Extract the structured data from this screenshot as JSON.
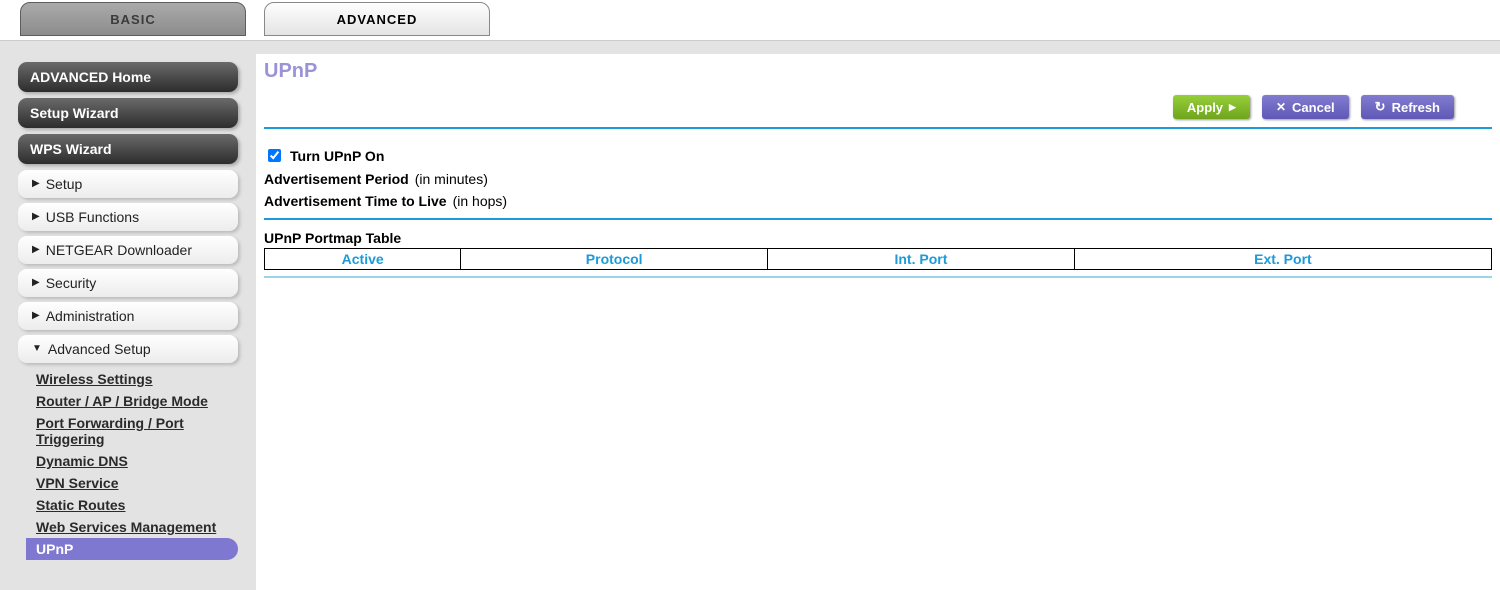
{
  "tabs": {
    "basic": "BASIC",
    "advanced": "ADVANCED"
  },
  "sidebar": {
    "advanced_home": "ADVANCED Home",
    "setup_wizard": "Setup Wizard",
    "wps_wizard": "WPS Wizard",
    "setup": "Setup",
    "usb_functions": "USB Functions",
    "netgear_downloader": "NETGEAR Downloader",
    "security": "Security",
    "administration": "Administration",
    "advanced_setup": "Advanced Setup",
    "sub": {
      "wireless_settings": "Wireless Settings",
      "router_mode": "Router / AP / Bridge Mode",
      "port_forwarding": "Port Forwarding / Port Triggering",
      "dynamic_dns": "Dynamic DNS",
      "vpn_service": "VPN Service",
      "static_routes": "Static Routes",
      "web_services": "Web Services Management",
      "upnp": "UPnP"
    }
  },
  "page": {
    "title": "UPnP",
    "turn_on_label": "Turn UPnP On",
    "adv_period_label": "Advertisement Period",
    "adv_period_unit": "(in minutes)",
    "ttl_label": "Advertisement Time to Live",
    "ttl_unit": "(in hops)",
    "table_title": "UPnP Portmap Table",
    "columns": {
      "active": "Active",
      "protocol": "Protocol",
      "int_port": "Int. Port",
      "ext_port": "Ext. Port"
    }
  },
  "buttons": {
    "apply": "Apply",
    "cancel": "Cancel",
    "refresh": "Refresh"
  }
}
